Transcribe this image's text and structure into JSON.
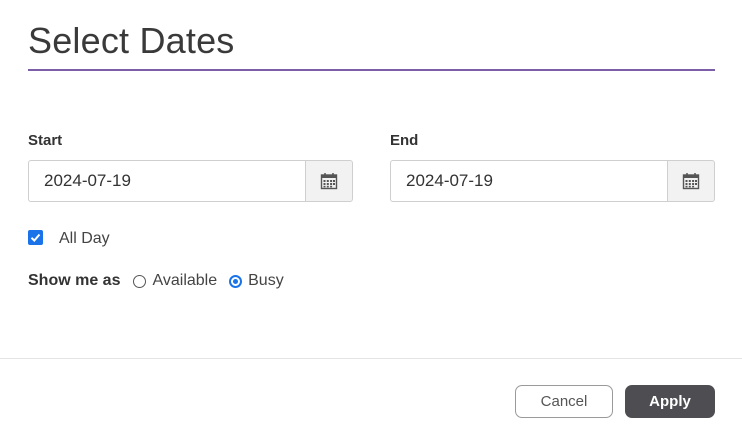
{
  "dialog": {
    "title": "Select Dates"
  },
  "start": {
    "label": "Start",
    "value": "2024-07-19",
    "icon": "calendar-icon"
  },
  "end": {
    "label": "End",
    "value": "2024-07-19",
    "icon": "calendar-icon"
  },
  "all_day": {
    "label": "All Day",
    "checked": true
  },
  "show_me_as": {
    "label": "Show me as",
    "options": [
      "Available",
      "Busy"
    ],
    "selected": "Busy"
  },
  "buttons": {
    "cancel": "Cancel",
    "apply": "Apply"
  },
  "colors": {
    "accent_rule": "#7b5ea7",
    "check_blue": "#1a73e8",
    "apply_bg": "#4d4d52"
  }
}
